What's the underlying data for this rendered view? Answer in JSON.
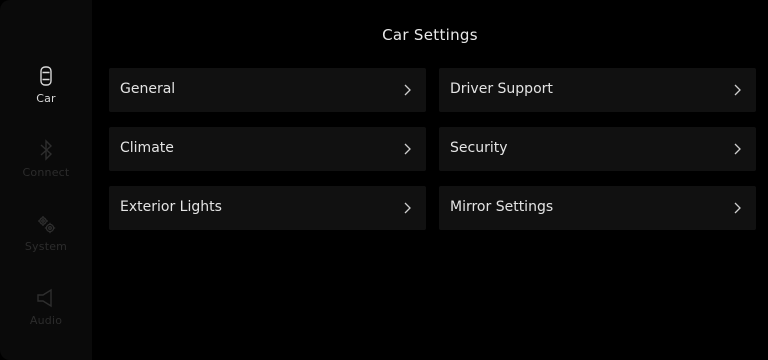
{
  "header": {
    "title": "Car Settings"
  },
  "sidebar": {
    "items": [
      {
        "label": "Car",
        "icon": "car-icon",
        "active": true
      },
      {
        "label": "Connect",
        "icon": "bluetooth-icon",
        "active": false
      },
      {
        "label": "System",
        "icon": "gears-icon",
        "active": false
      },
      {
        "label": "Audio",
        "icon": "speaker-icon",
        "active": false
      }
    ]
  },
  "menu": {
    "items": [
      {
        "label": "General"
      },
      {
        "label": "Driver Support"
      },
      {
        "label": "Climate"
      },
      {
        "label": "Security"
      },
      {
        "label": "Exterior Lights"
      },
      {
        "label": "Mirror Settings"
      }
    ]
  },
  "colors": {
    "background": "#000000",
    "tile": "#111111",
    "text": "#e4e4e4",
    "inactive": "#2c2c2c"
  }
}
